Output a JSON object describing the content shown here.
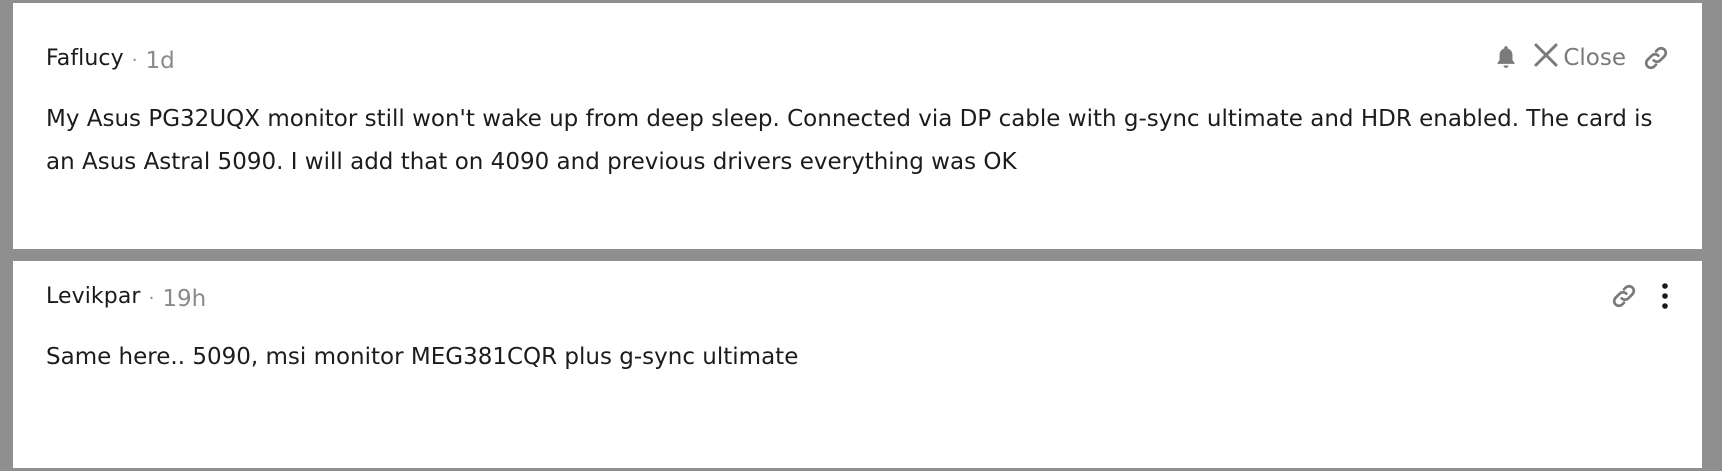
{
  "comments": [
    {
      "author": "Faflucy",
      "separator": "·",
      "time": "1d",
      "close_label": "Close",
      "body": "My Asus PG32UQX monitor still won't wake up from deep sleep. Connected via DP cable with g-sync ultimate and HDR enabled. The card is an Asus Astral 5090. I will add that on 4090 and previous drivers everything was OK"
    },
    {
      "author": "Levikpar",
      "separator": "·",
      "time": "19h",
      "body": "Same here.. 5090, msi monitor MEG381CQR plus g-sync ultimate"
    }
  ],
  "icons": {
    "bell": "bell-icon",
    "close": "close-icon",
    "link": "link-icon",
    "more": "more-vertical-icon"
  },
  "colors": {
    "background": "#8f8f8f",
    "card": "#ffffff",
    "text": "#1c1c1c",
    "muted": "#8a8a8a"
  }
}
